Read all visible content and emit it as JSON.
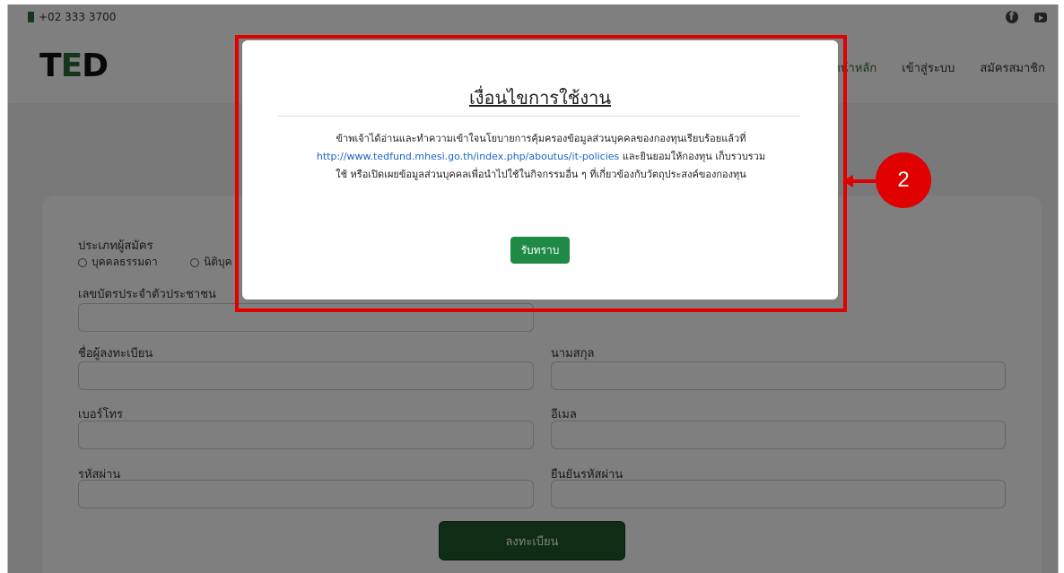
{
  "topbar": {
    "phone": "+02 333 3700",
    "social": [
      "facebook-icon",
      "youtube-icon"
    ]
  },
  "header": {
    "logo": {
      "left": "T",
      "mid": "E",
      "right": "D"
    },
    "nav": [
      "หน้าหลัก",
      "เข้าสู่ระบบ",
      "สมัครสมาชิก"
    ]
  },
  "form": {
    "applicant_type_label": "ประเภทผู้สมัคร",
    "radio_options": [
      "บุคคลธรรมดา",
      "นิติบุค"
    ],
    "id_card_label": "เลขบัตรประจำตัวประชาชน",
    "firstname_label": "ชื่อผู้ลงทะเบียน",
    "lastname_label": "นามสกุล",
    "phone_label": "เบอร์โทร",
    "email_label": "อีเมล",
    "password_label": "รหัสผ่าน",
    "confirm_password_label": "ยืนยันรหัสผ่าน",
    "submit_label": "ลงทะเบียน"
  },
  "modal": {
    "title": "เงื่อนไขการใช้งาน",
    "body_line1": "ข้าพเจ้าได้อ่านและทำความเข้าใจนโยบายการคุ้มครองข้อมูลส่วนบุคคลของกองทุนเรียบร้อยแล้วที่",
    "link": "http://www.tedfund.mhesi.go.th/index.php/aboutus/it-policies",
    "body_line2_after_link": " และยินยอมให้กองทุน เก็บรวบรวม",
    "body_line3": "ใช้ หรือเปิดเผยข้อมูลส่วนบุคคลเพื่อนำไปใช้ในกิจกรรมอื่น ๆ ที่เกี่ยวข้องกับวัตถุประสงค์ของกองทุน",
    "accept_label": "รับทราบ"
  },
  "annotation": {
    "callout_number": "2",
    "color": "#e00000"
  }
}
